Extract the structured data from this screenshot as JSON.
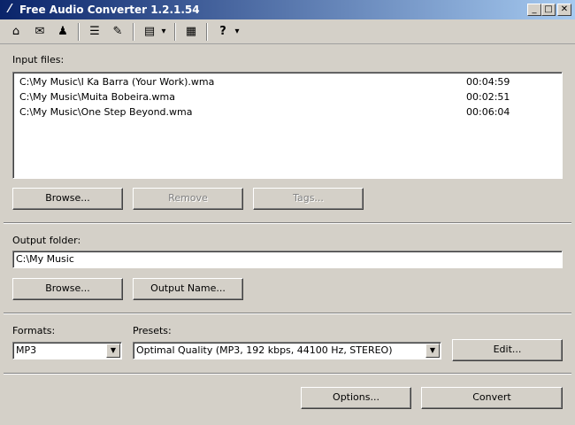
{
  "window": {
    "title": "Free Audio Converter 1.2.1.54",
    "minimize": "_",
    "maximize": "□",
    "close": "✕"
  },
  "toolbar": {
    "home": "⌂",
    "mail": "✉",
    "user": "♟",
    "list": "☰",
    "edit": "✎",
    "menu": "▤",
    "dropdown": "▾",
    "film": "▦",
    "help": "?",
    "help_dropdown": "▾"
  },
  "input": {
    "label": "Input files:",
    "files": [
      {
        "path": "C:\\My Music\\I Ka Barra (Your Work).wma",
        "duration": "00:04:59"
      },
      {
        "path": "C:\\My Music\\Muita Bobeira.wma",
        "duration": "00:02:51"
      },
      {
        "path": "C:\\My Music\\One Step Beyond.wma",
        "duration": "00:06:04"
      }
    ],
    "browse_label": "Browse...",
    "remove_label": "Remove",
    "tags_label": "Tags..."
  },
  "output": {
    "label": "Output folder:",
    "folder": "C:\\My Music",
    "browse_label": "Browse...",
    "output_name_label": "Output Name..."
  },
  "formats": {
    "label": "Formats:",
    "selected": "MP3"
  },
  "presets": {
    "label": "Presets:",
    "selected": "Optimal Quality (MP3, 192 kbps, 44100 Hz, STEREO)",
    "edit_label": "Edit..."
  },
  "footer": {
    "options_label": "Options...",
    "convert_label": "Convert"
  },
  "colors": {
    "face": "#d4d0c8",
    "title_start": "#0a246a",
    "title_end": "#a6caf0"
  }
}
